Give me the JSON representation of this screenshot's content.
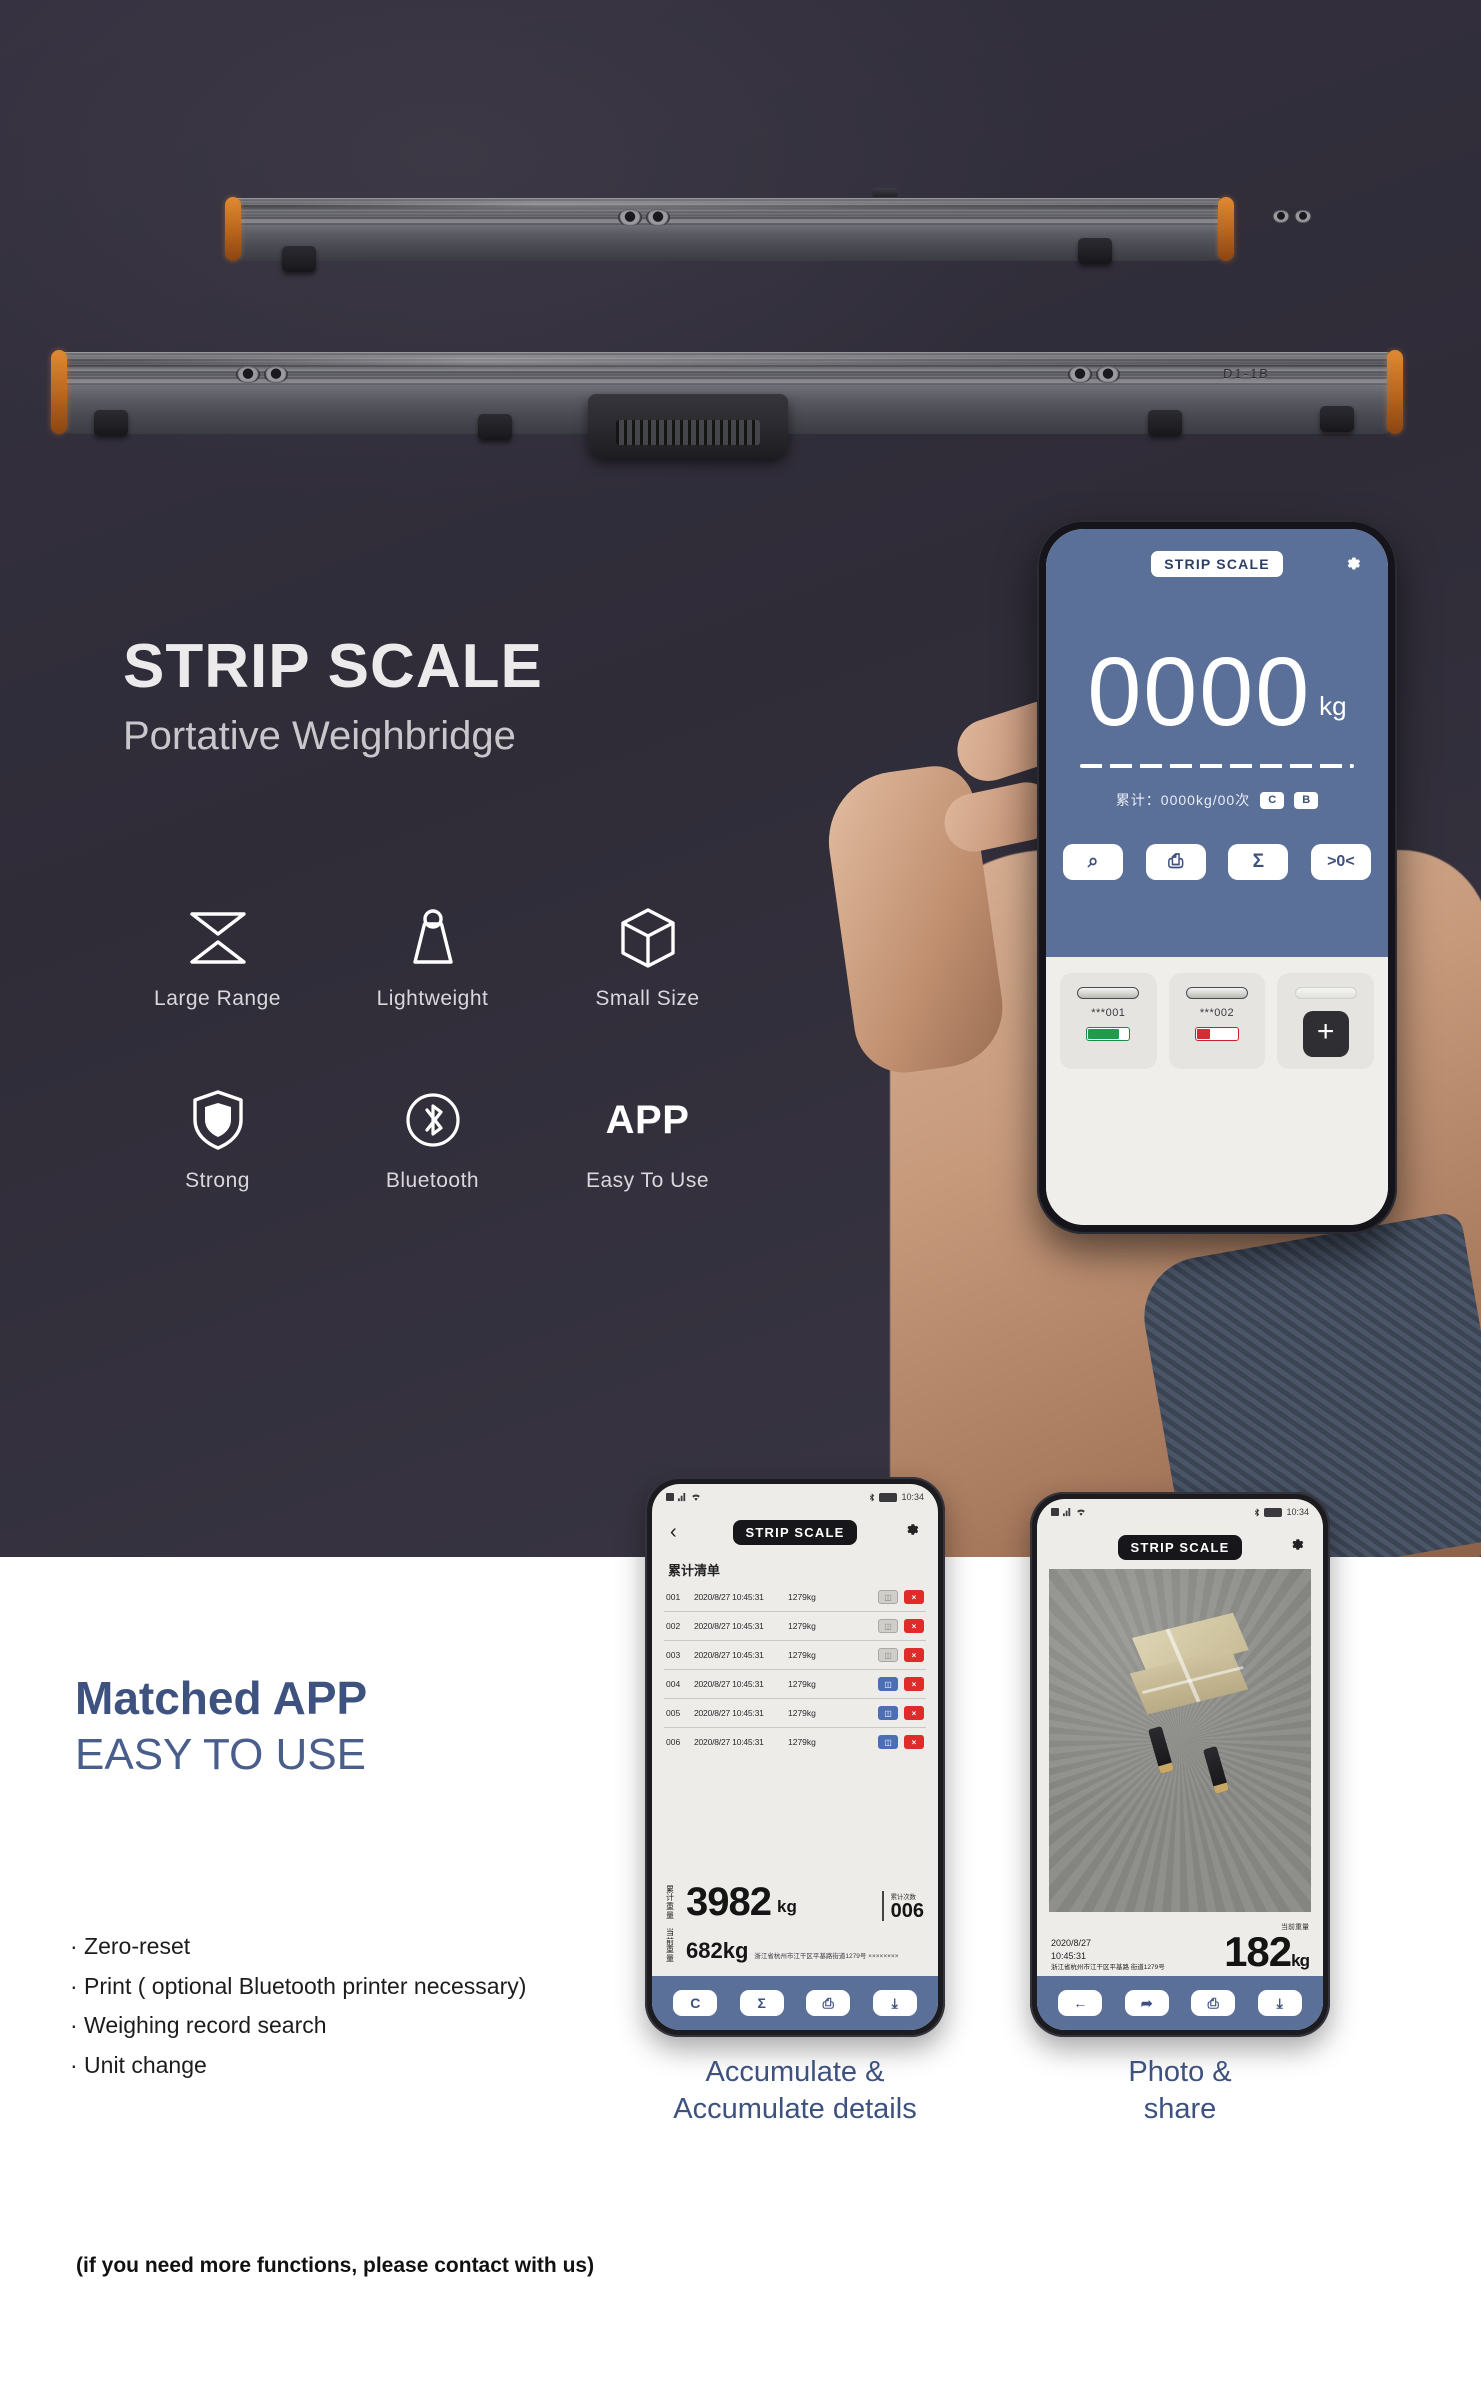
{
  "hero": {
    "title": "STRIP SCALE",
    "subtitle": "Portative Weighbridge",
    "product_marking": "D1-1B"
  },
  "features": [
    {
      "label": "Large  Range",
      "icon": "range-hourglass-icon"
    },
    {
      "label": "Lightweight",
      "icon": "weight-icon"
    },
    {
      "label": "Small  Size",
      "icon": "cube-icon"
    },
    {
      "label": "Strong",
      "icon": "shield-icon"
    },
    {
      "label": "Bluetooth",
      "icon": "bluetooth-icon"
    },
    {
      "label": "Easy  To  Use",
      "icon": "app-text-icon",
      "headline": "APP"
    }
  ],
  "main_phone": {
    "brand": "STRIP SCALE",
    "gear_icon": "gear-icon",
    "weight_value": "0000",
    "weight_unit": "kg",
    "accumulate_text": "累计：0000kg/00次",
    "mini_buttons": [
      "C",
      "B"
    ],
    "actions": [
      {
        "name": "photo-button",
        "glyph": "⌕"
      },
      {
        "name": "print-button",
        "glyph": "⎙"
      },
      {
        "name": "accumulate-button",
        "glyph": "Σ"
      },
      {
        "name": "zero-button",
        "glyph": ">0<"
      }
    ],
    "devices": [
      {
        "id": "***001",
        "battery": "green",
        "battery_pct": 78
      },
      {
        "id": "***002",
        "battery": "red",
        "battery_pct": 32
      }
    ],
    "add_button": "+"
  },
  "lower": {
    "heading": "Matched APP",
    "subheading": "EASY TO USE",
    "bullets": [
      "· Zero-reset",
      "· Print ( optional Bluetooth printer necessary)",
      "· Weighing record search",
      "· Unit change"
    ],
    "footnote": "(if you need more functions, please contact with us)"
  },
  "phone_list": {
    "brand": "STRIP SCALE",
    "back_glyph": "‹",
    "gear_icon": "gear-icon",
    "list_title": "累计清单",
    "status_time": "10:34",
    "columns": [
      "index",
      "datetime",
      "weight"
    ],
    "rows": [
      {
        "index": "001",
        "datetime": "2020/8/27 10:45:31",
        "weight": "1279kg",
        "photo": "gray",
        "delete": "×"
      },
      {
        "index": "002",
        "datetime": "2020/8/27 10:45:31",
        "weight": "1279kg",
        "photo": "gray",
        "delete": "×"
      },
      {
        "index": "003",
        "datetime": "2020/8/27 10:45:31",
        "weight": "1279kg",
        "photo": "gray",
        "delete": "×"
      },
      {
        "index": "004",
        "datetime": "2020/8/27 10:45:31",
        "weight": "1279kg",
        "photo": "blue",
        "delete": "×"
      },
      {
        "index": "005",
        "datetime": "2020/8/27 10:45:31",
        "weight": "1279kg",
        "photo": "blue",
        "delete": "×"
      },
      {
        "index": "006",
        "datetime": "2020/8/27 10:45:31",
        "weight": "1279kg",
        "photo": "blue",
        "delete": "×"
      }
    ],
    "summary": {
      "total_label": "累计\n重量",
      "total_value": "3982",
      "total_unit": "kg",
      "count_label": "累计次数",
      "count_value": "006",
      "single_label": "当前\n重量",
      "single_value": "682kg",
      "address": "浙江省杭州市江干区平基路街道1279号\n××××××××"
    },
    "buttons": [
      {
        "name": "clear-button",
        "glyph": "C"
      },
      {
        "name": "accumulate-button",
        "glyph": "Σ"
      },
      {
        "name": "print-button",
        "glyph": "⎙"
      },
      {
        "name": "save-button",
        "glyph": "⤓"
      }
    ]
  },
  "phone_photo": {
    "brand": "STRIP SCALE",
    "gear_icon": "gear-icon",
    "status_time": "10:34",
    "date": "2020/8/27",
    "time": "10:45:31",
    "address": "浙江省杭州市江干区平基路\n街道1279号",
    "weight_label": "当前重量",
    "weight_value": "182",
    "weight_unit": "kg",
    "buttons": [
      {
        "name": "back-button",
        "glyph": "←"
      },
      {
        "name": "share-button",
        "glyph": "➦"
      },
      {
        "name": "print-button",
        "glyph": "⎙"
      },
      {
        "name": "save-button",
        "glyph": "⤓"
      }
    ]
  },
  "captions": {
    "left": "Accumulate &\nAccumulate details",
    "right": "Photo &\nshare"
  },
  "colors": {
    "hero_bg": "#332f3a",
    "app_blue": "#5b7098",
    "heading_blue": "#3e5280",
    "accent_orange": "#e08a33",
    "delete_red": "#e02b2b",
    "battery_green": "#1f9c4b"
  }
}
